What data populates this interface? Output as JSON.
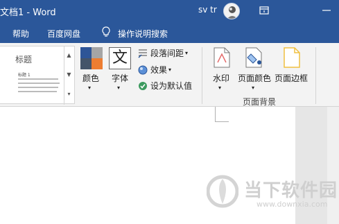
{
  "titlebar": {
    "doc_title": "文档1 - Word",
    "user_name": "sv tr",
    "restore_icon": "restore-icon",
    "minimize_icon": "minimize-icon"
  },
  "ribbon_tabs": {
    "help": "帮助",
    "baidu_netdisk": "百度网盘",
    "tell_me": "操作说明搜索",
    "tell_me_icon": "lightbulb-icon"
  },
  "style_gallery": {
    "heading": "标题",
    "subheading": "标题 1"
  },
  "design": {
    "colors_label": "颜色",
    "fonts_label": "字体",
    "fonts_glyph": "文",
    "paragraph_spacing_label": "段落间距",
    "effects_label": "效果",
    "set_default_label": "设为默认值"
  },
  "page_background": {
    "watermark_label": "水印",
    "page_color_label": "页面颜色",
    "page_borders_label": "页面边框",
    "group_label": "页面背景"
  },
  "watermark_overlay": {
    "main_text": "当下软件园",
    "url": "www.downxia.com"
  },
  "colors": {
    "ribbon_blue": "#2b579a",
    "swatch_blue": "#2e5597",
    "swatch_orange": "#ed7d31",
    "swatch_gray": "#a5a5a5",
    "swatch_navy": "#44546a"
  }
}
